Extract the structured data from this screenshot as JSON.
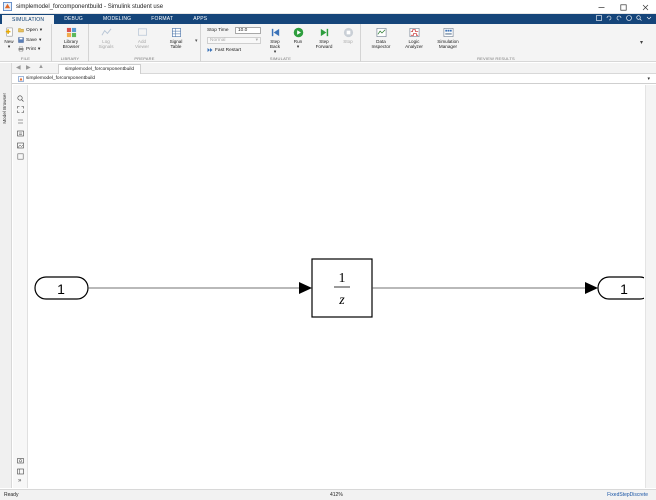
{
  "window": {
    "title": "simplemodel_forcomponentbuild - Simulink student use"
  },
  "ribbon_tabs": [
    {
      "label": "SIMULATION",
      "active": true
    },
    {
      "label": "DEBUG"
    },
    {
      "label": "MODELING"
    },
    {
      "label": "FORMAT"
    },
    {
      "label": "APPS"
    }
  ],
  "ribbon": {
    "file": {
      "new_label": "New",
      "open_label": "Open",
      "save_label": "Save",
      "print_label": "Print",
      "group_label": "FILE"
    },
    "library": {
      "library_browser_label": "Library Browser",
      "group_label": "LIBRARY"
    },
    "prepare": {
      "log_signals_label": "Log Signals",
      "add_viewer_label": "Add Viewer",
      "signal_table_label": "Signal Table",
      "group_label": "PREPARE"
    },
    "simulate": {
      "stop_time_label": "Stop Time",
      "stop_time_value": "10.0",
      "mode_value": "Normal",
      "fast_restart_label": "Fast Restart",
      "step_back_label": "Step Back",
      "run_label": "Run",
      "step_forward_label": "Step Forward",
      "stop_label": "Stop",
      "group_label": "SIMULATE"
    },
    "review": {
      "data_inspector_label": "Data Inspector",
      "logic_analyzer_label": "Logic Analyzer",
      "simulation_manager_label": "Simulation Manager",
      "group_label": "REVIEW RESULTS"
    }
  },
  "model_browser_label": "Model Browser",
  "model_tab_label": "simplemodel_forcomponentbuild",
  "breadcrumb_label": "simplemodel_forcomponentbuild",
  "diagram": {
    "inport_label": "1",
    "unit_delay_numerator": "1",
    "unit_delay_denominator": "z",
    "outport_label": "1"
  },
  "status": {
    "left": "Ready",
    "zoom": "412%",
    "solver": "FixedStepDiscrete"
  },
  "colors": {
    "ribbon_tab_bar": "#15457a",
    "ribbon_body": "#f4f4f4"
  }
}
